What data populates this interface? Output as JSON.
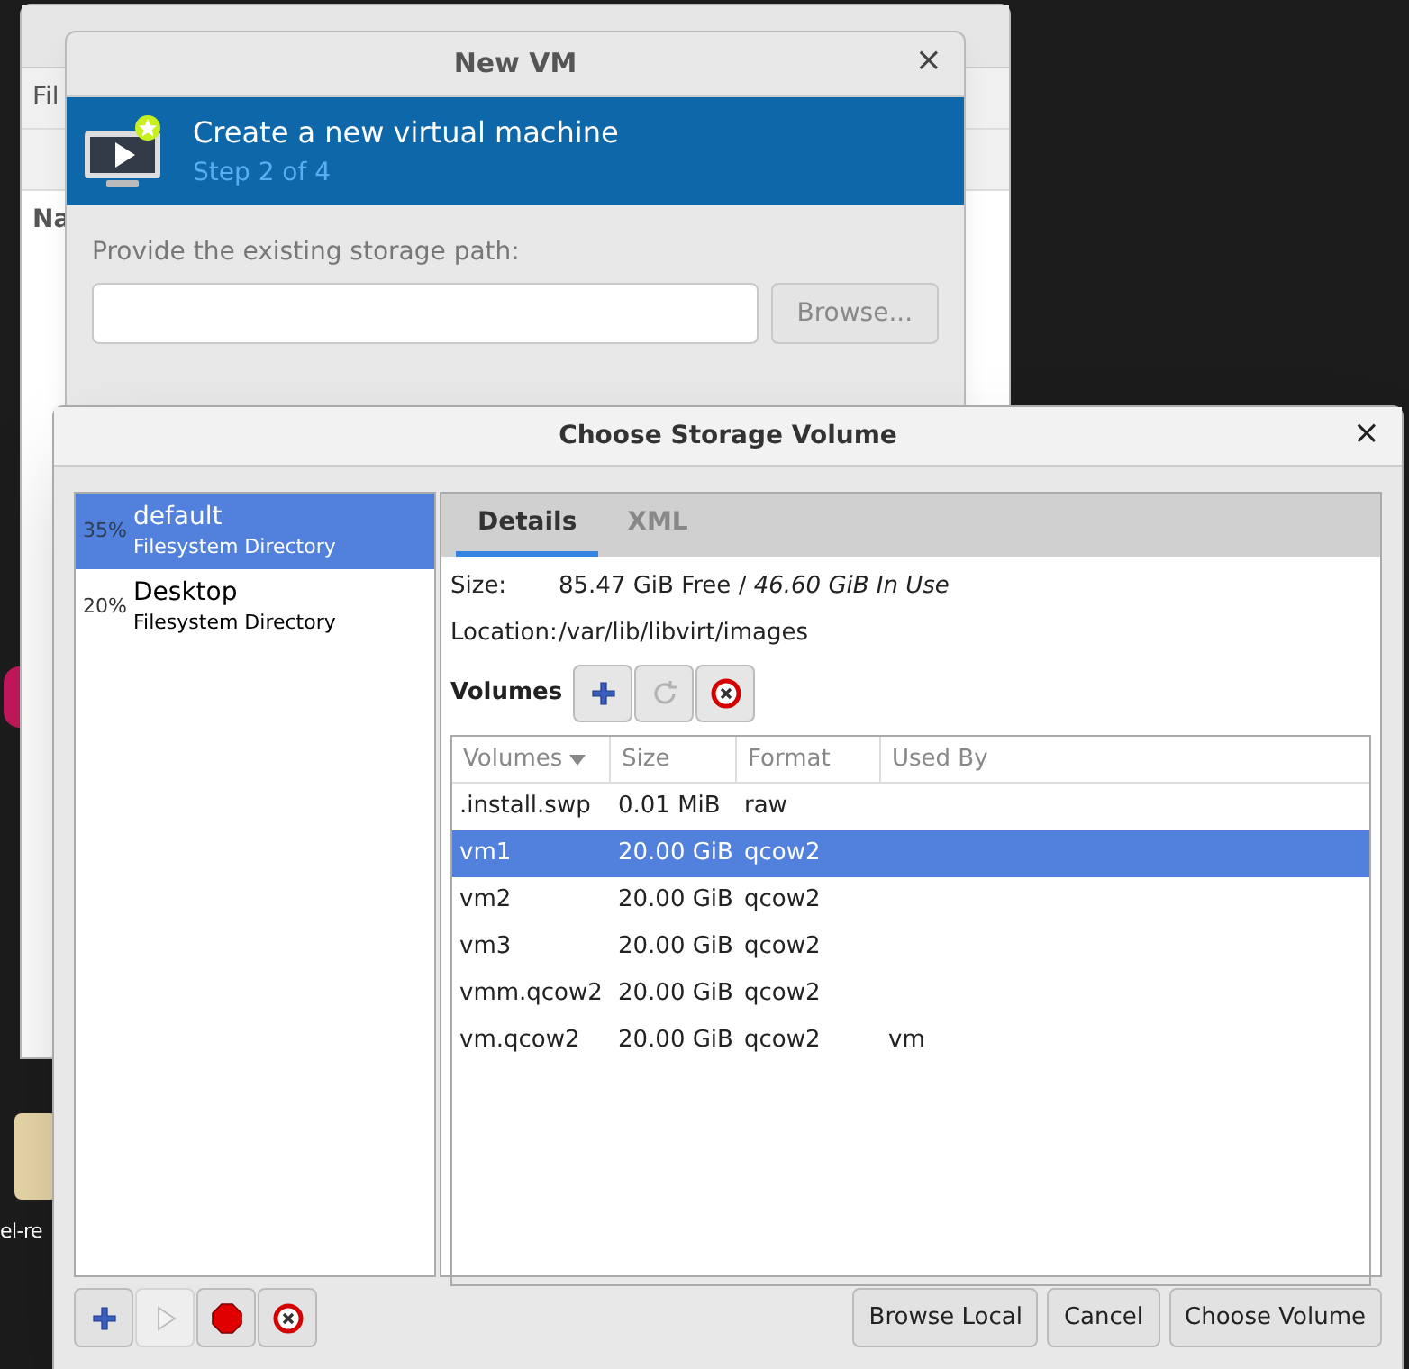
{
  "desktop": {
    "icon_label": "el-re"
  },
  "background_window": {
    "menu_item": "Fil",
    "column_header": "Na"
  },
  "new_vm": {
    "title": "New VM",
    "close": "×",
    "heading": "Create a new virtual machine",
    "step": "Step 2 of 4",
    "path_label": "Provide the existing storage path:",
    "browse_button": "Browse..."
  },
  "storage_dialog": {
    "title": "Choose Storage Volume",
    "close": "×",
    "pools": [
      {
        "usage": "35%",
        "name": "default",
        "type": "Filesystem Directory",
        "selected": true
      },
      {
        "usage": "20%",
        "name": "Desktop",
        "type": "Filesystem Directory",
        "selected": false
      }
    ],
    "tabs": [
      {
        "label": "Details",
        "selected": true
      },
      {
        "label": "XML",
        "selected": false
      }
    ],
    "size_label": "Size:",
    "size_free": "85.47 GiB Free",
    "size_separator": "/",
    "size_in_use": "46.60 GiB In Use",
    "location_label": "Location:",
    "location": "/var/lib/libvirt/images",
    "volumes_label": "Volumes",
    "volume_tools": [
      {
        "kind": "add",
        "disabled": false
      },
      {
        "kind": "refresh",
        "disabled": true
      },
      {
        "kind": "delete",
        "disabled": false
      }
    ],
    "table": {
      "columns": [
        "Volumes",
        "Size",
        "Format",
        "Used By"
      ],
      "rows": [
        {
          "cells": [
            ".install.swp",
            "0.01 MiB",
            "raw",
            ""
          ],
          "selected": false
        },
        {
          "cells": [
            "vm1",
            "20.00 GiB",
            "qcow2",
            ""
          ],
          "selected": true
        },
        {
          "cells": [
            "vm2",
            "20.00 GiB",
            "qcow2",
            ""
          ],
          "selected": false
        },
        {
          "cells": [
            "vm3",
            "20.00 GiB",
            "qcow2",
            ""
          ],
          "selected": false
        },
        {
          "cells": [
            "vmm.qcow2",
            "20.00 GiB",
            "qcow2",
            ""
          ],
          "selected": false
        },
        {
          "cells": [
            "vm.qcow2",
            "20.00 GiB",
            "qcow2",
            "vm"
          ],
          "selected": false
        }
      ]
    },
    "pool_tools": [
      {
        "kind": "add",
        "disabled": false
      },
      {
        "kind": "start",
        "disabled": true
      },
      {
        "kind": "stop",
        "disabled": false
      },
      {
        "kind": "delete",
        "disabled": false
      }
    ],
    "buttons": [
      "Browse Local",
      "Cancel",
      "Choose Volume"
    ]
  }
}
